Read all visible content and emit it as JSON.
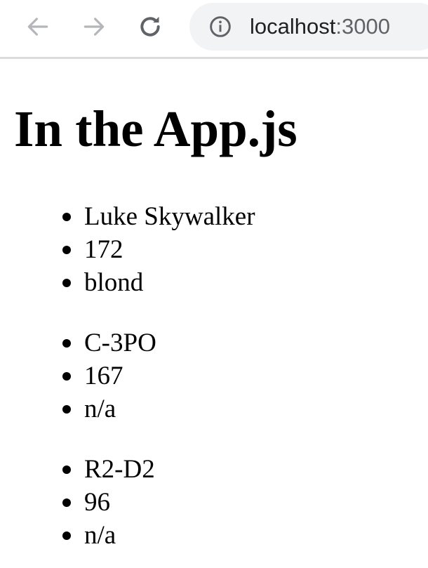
{
  "browser": {
    "url_host": "localhost",
    "url_port": ":3000",
    "icons": {
      "back": "arrow-left-icon",
      "forward": "arrow-right-icon",
      "reload": "reload-icon",
      "info": "info-icon"
    }
  },
  "page": {
    "heading": "In the App.js",
    "characters": [
      {
        "name": "Luke Skywalker",
        "height": "172",
        "hair_color": "blond"
      },
      {
        "name": "C-3PO",
        "height": "167",
        "hair_color": "n/a"
      },
      {
        "name": "R2-D2",
        "height": "96",
        "hair_color": "n/a"
      }
    ]
  }
}
